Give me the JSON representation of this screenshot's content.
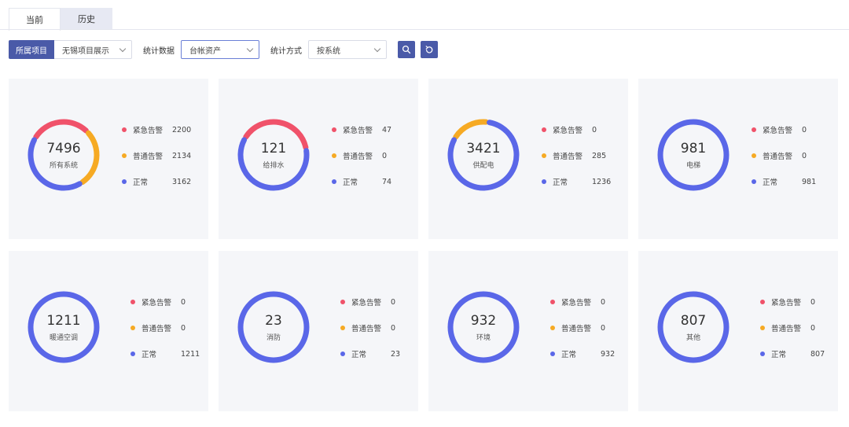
{
  "tabs": [
    {
      "label": "当前",
      "active": true
    },
    {
      "label": "历史",
      "active": false
    }
  ],
  "filters": {
    "project_label": "所属项目",
    "project_value": "无锡项目展示",
    "data_label": "统计数据",
    "data_value": "台帐资产",
    "method_label": "统计方式",
    "method_value": "按系统"
  },
  "colors": {
    "urgent": "#f0526a",
    "normal_alarm": "#f6aa24",
    "ok": "#5a67e8",
    "primary": "#4a5aa8"
  },
  "legend_labels": {
    "urgent": "紧急告警",
    "normal_alarm": "普通告警",
    "ok": "正常"
  },
  "cards": [
    {
      "total": "7496",
      "category": "所有系统",
      "urgent": 2200,
      "normal_alarm": 2134,
      "ok": 3162
    },
    {
      "total": "121",
      "category": "给排水",
      "urgent": 47,
      "normal_alarm": 0,
      "ok": 74
    },
    {
      "total": "3421",
      "category": "供配电",
      "urgent": 0,
      "normal_alarm": 285,
      "ok": 1236
    },
    {
      "total": "981",
      "category": "电梯",
      "urgent": 0,
      "normal_alarm": 0,
      "ok": 981
    },
    {
      "total": "1211",
      "category": "暖通空调",
      "urgent": 0,
      "normal_alarm": 0,
      "ok": 1211
    },
    {
      "total": "23",
      "category": "消防",
      "urgent": 0,
      "normal_alarm": 0,
      "ok": 23
    },
    {
      "total": "932",
      "category": "环境",
      "urgent": 0,
      "normal_alarm": 0,
      "ok": 932
    },
    {
      "total": "807",
      "category": "其他",
      "urgent": 0,
      "normal_alarm": 0,
      "ok": 807
    }
  ]
}
